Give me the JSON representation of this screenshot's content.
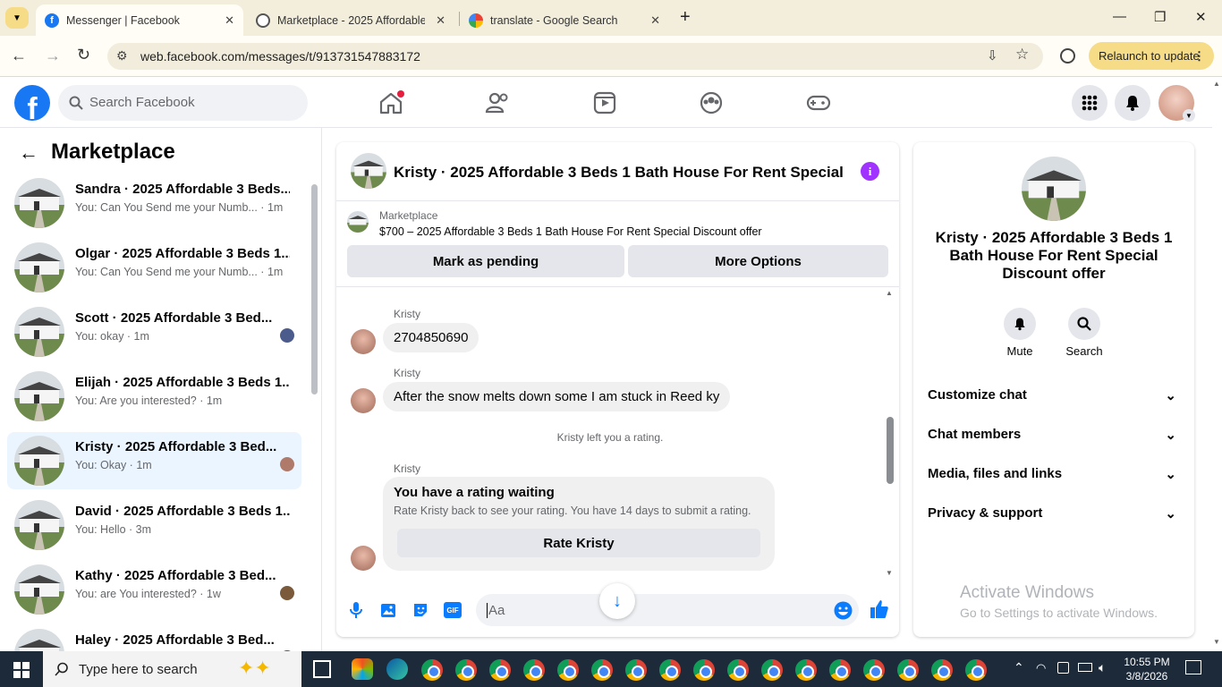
{
  "browser": {
    "tabs": [
      {
        "title": "Messenger | Facebook",
        "active": true
      },
      {
        "title": "Marketplace - 2025 Affordable",
        "active": false
      },
      {
        "title": "translate - Google Search",
        "active": false
      }
    ],
    "url": "web.facebook.com/messages/t/913731547883172",
    "relaunch_label": "Relaunch to update"
  },
  "fb_header": {
    "search_placeholder": "Search Facebook"
  },
  "sidebar": {
    "title": "Marketplace",
    "conversations": [
      {
        "name": "Sandra · 2025 Affordable 3 Beds...",
        "preview": "You: Can You Send me your Numb... · 1m"
      },
      {
        "name": "Olgar · 2025 Affordable 3 Beds 1...",
        "preview": "You: Can You Send me your Numb... · 1m"
      },
      {
        "name": "Scott · 2025 Affordable 3 Bed...",
        "preview": "You: okay · 1m"
      },
      {
        "name": "Elijah · 2025 Affordable 3 Beds 1...",
        "preview": "You: Are you interested? · 1m"
      },
      {
        "name": "Kristy · 2025 Affordable 3 Bed...",
        "preview": "You: Okay · 1m"
      },
      {
        "name": "David · 2025 Affordable 3 Beds 1...",
        "preview": "You: Hello · 3m"
      },
      {
        "name": "Kathy · 2025 Affordable 3 Bed...",
        "preview": "You: are You interested? · 1w"
      },
      {
        "name": "Haley · 2025 Affordable 3 Bed...",
        "preview": ""
      }
    ]
  },
  "chat": {
    "title": "Kristy · 2025 Affordable 3 Beds 1 Bath House For Rent Special D...",
    "listing_source": "Marketplace",
    "listing_line": "$700 – 2025 Affordable 3 Beds 1 Bath House For Rent Special Discount offer",
    "mark_pending_label": "Mark as pending",
    "more_options_label": "More Options",
    "messages": [
      {
        "sender": "Kristy",
        "text": "2704850690"
      },
      {
        "sender": "Kristy",
        "text": "After the snow melts down some I am stuck in Reed ky"
      }
    ],
    "system_note": "Kristy left you a rating.",
    "rating_card": {
      "sender": "Kristy",
      "title": "You have a rating waiting",
      "body": "Rate Kristy back to see your rating. You have 14 days to submit a rating.",
      "button": "Rate Kristy"
    },
    "composer_placeholder": "Aa",
    "gif_label": "GIF"
  },
  "details": {
    "title": "Kristy · 2025 Affordable 3 Beds 1 Bath House For Rent Special Discount offer",
    "mute_label": "Mute",
    "search_label": "Search",
    "sections": [
      "Customize chat",
      "Chat members",
      "Media, files and links",
      "Privacy & support"
    ],
    "watermark_title": "Activate Windows",
    "watermark_sub": "Go to Settings to activate Windows."
  },
  "taskbar": {
    "search_placeholder": "Type here to search",
    "time": "10:55 PM",
    "date": "3/8/2026"
  },
  "colors": {
    "fb_blue": "#1877f2",
    "accent_purple": "#a033ff",
    "tab_bg": "#f3eedb"
  }
}
